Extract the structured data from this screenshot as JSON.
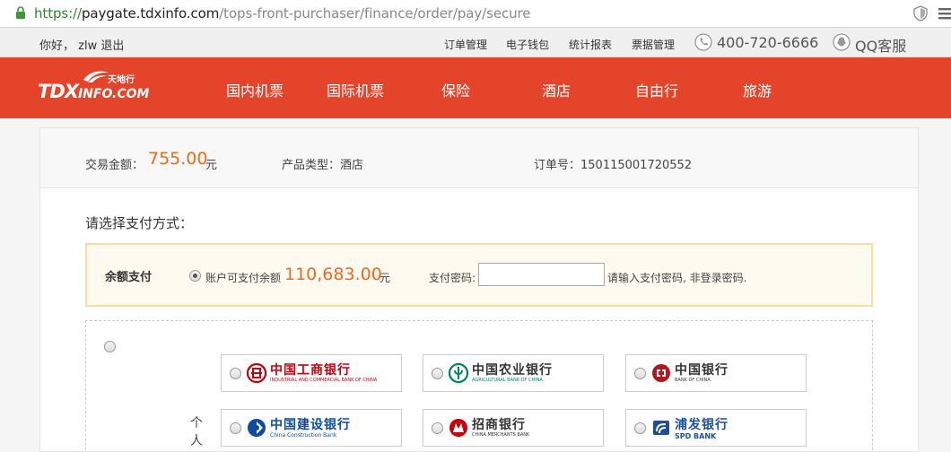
{
  "browser": {
    "url_scheme": "https://",
    "url_host": "paygate.tdxinfo.com",
    "url_path": "/tops-front-purchaser/finance/order/pay/secure"
  },
  "topbar": {
    "greeting": "你好， zlw 退出",
    "links": [
      "订单管理",
      "电子钱包",
      "统计报表",
      "票据管理"
    ],
    "phone": "400-720-6666",
    "qq": "QQ客服"
  },
  "logo": {
    "main": "TDX",
    "sub": "INFO.COM",
    "cn": "天地行"
  },
  "nav": {
    "items": [
      "国内机票",
      "国际机票",
      "保险",
      "酒店",
      "自由行",
      "旅游"
    ]
  },
  "summary": {
    "amount_label": "交易金额：",
    "amount": "755.00",
    "amount_unit": "元",
    "product_label": "产品类型：酒店",
    "order_label": "订单号：150115001720552"
  },
  "payment": {
    "choose_label": "请选择支付方式：",
    "balance_title": "余额支付",
    "balance_label": "账户可支付余额",
    "balance_amount": "110,683.00",
    "balance_unit": "元",
    "password_label": "支付密码:",
    "password_value": "",
    "password_hint": "请输入支付密码, 非登录密码."
  },
  "banks": {
    "group_label": "个人",
    "items": [
      {
        "cn": "中国工商银行",
        "en": "INDUSTRIAL AND COMMERCIAL BANK OF CHINA",
        "color": "#c7000b"
      },
      {
        "cn": "中国农业银行",
        "en": "AGRICULTURAL BANK OF CHINA",
        "color": "#00836b"
      },
      {
        "cn": "中国银行",
        "en": "BANK OF CHINA",
        "color": "#b0171f"
      },
      {
        "cn": "中国建设银行",
        "en": "China Construction Bank",
        "color": "#0c4da2"
      },
      {
        "cn": "招商银行",
        "en": "CHINA MERCHANTS BANK",
        "color": "#c7000b"
      },
      {
        "cn": "浦发银行",
        "en": "SPD BANK",
        "color": "#1d4e9a"
      }
    ]
  },
  "colors": {
    "nav_bg": "#e4442a",
    "amount": "#ee6a1e",
    "balance_border": "#fbdca0"
  }
}
